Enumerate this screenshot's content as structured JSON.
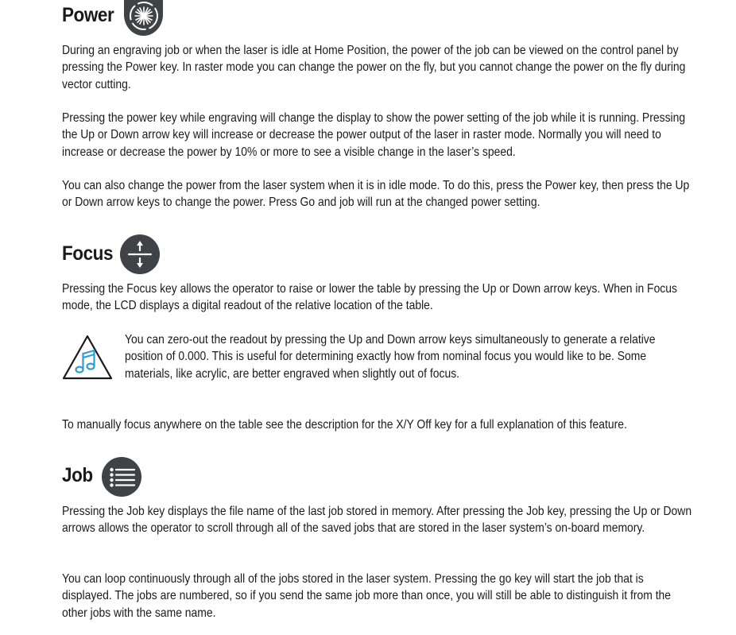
{
  "sections": {
    "power": {
      "title": "Power",
      "paragraphs": [
        "During an engraving job or when the laser is idle at Home Position, the power of the job can be viewed on the control panel by pressing the Power key. In raster mode you can change the power on the fly, but you cannot change the power on the fly during vector cutting.",
        "Pressing the power key while engraving will change the display to show the power setting of the job while it is running. Pressing the Up or Down arrow key will increase or decrease the power output of the laser in raster mode. Normally you will need to increase or decrease the power by 10% or more to see a visible change in the laser’s speed.",
        "You can also change the power from the laser system when it is in idle mode. To do this, press the Power key, then press the Up or Down arrow keys to change the power. Press Go and job will run at the changed power setting."
      ],
      "icon": "laser-burst-icon"
    },
    "focus": {
      "title": "Focus",
      "paragraphs": [
        "Pressing the Focus key allows the operator to raise or lower the table by pressing the Up or Down arrow keys. When in Focus mode, the LCD displays a digital readout of the relative location of the table.",
        "To manually focus anywhere on the table see the description for the X/Y Off key for a full explanation of this feature."
      ],
      "note": "You can zero-out the readout by pressing the Up and Down arrow keys simultaneously to generate a relative position of 0.000. This is useful for determining exactly how from nominal focus you would like to be. Some materials, like acrylic, are better engraved when slightly out of focus.",
      "icon": "focus-arrows-icon",
      "note_icon": "music-note-warning-icon"
    },
    "job": {
      "title": "Job",
      "paragraphs": [
        "Pressing the Job key displays the file name of the last job stored in memory. After pressing the Job key, pressing the Up or Down arrows allows the operator to scroll through all of the saved jobs that are stored in the laser system’s on-board memory.",
        "You can loop continuously through all of the jobs stored in the laser system. Pressing the go key will start the job that is displayed. The jobs are numbered, so if you send the same job more than once, you will still be able to distinguish it from the other jobs with the same name."
      ],
      "icon": "list-icon"
    }
  },
  "colors": {
    "icon_circle": "#404346",
    "icon_glyph": "#ffffff",
    "note_triangle": "#1a1a1a",
    "note_music": "#2a9fd6",
    "text": "#1a1a1a"
  }
}
